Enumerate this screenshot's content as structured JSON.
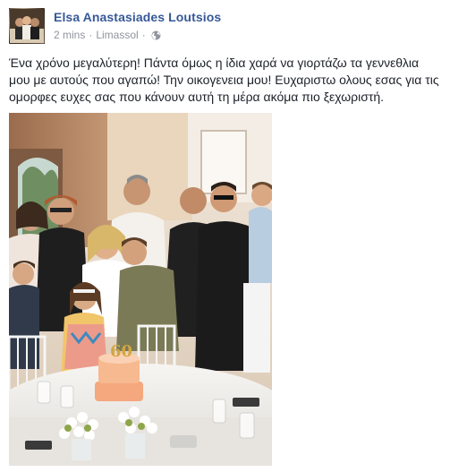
{
  "post": {
    "author": "Elsa Anastasiades Loutsios",
    "time": "2 mins",
    "separator": "·",
    "location": "Limassol",
    "privacy_icon": "globe-icon",
    "text": "Ένα χρόνο μεγαλύτερη! Πάντα όμως η ίδια χαρά να γιορτάζω τα γεννεθλια μου με αυτούς που αγαπώ! Την οικογενεια μου! Ευχαριστω ολους εσας για τις ομορφες ευχες σας που κάνουν αυτή τη μέρα ακόμα πιο ξεχωριστή."
  },
  "photo": {
    "cake_topper": "60"
  },
  "colors": {
    "author_link": "#365899",
    "meta_gray": "#90949c",
    "text": "#1d2129"
  }
}
